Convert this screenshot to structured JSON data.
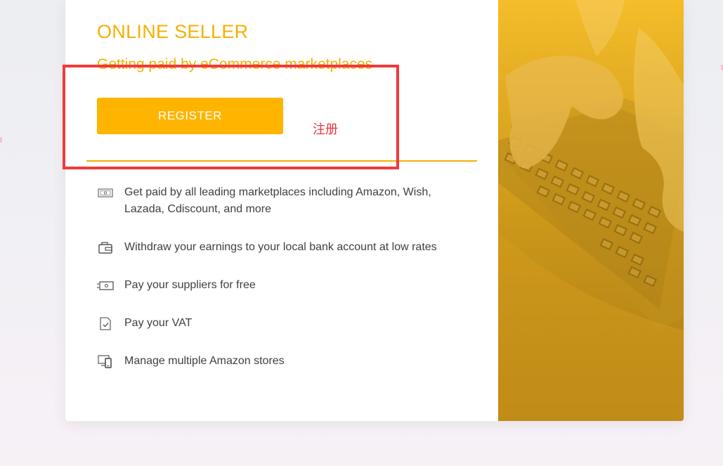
{
  "card": {
    "title": "ONLINE SELLER",
    "subtitle": "Getting paid by eCommerce marketplaces",
    "register_label": "REGISTER"
  },
  "features": [
    {
      "icon": "cash-icon",
      "text": "Get paid by all leading marketplaces including Amazon, Wish, Lazada, Cdiscount, and more"
    },
    {
      "icon": "wallet-icon",
      "text": "Withdraw your earnings to your local bank account at low rates"
    },
    {
      "icon": "money-transfer-icon",
      "text": "Pay your suppliers for free"
    },
    {
      "icon": "document-check-icon",
      "text": "Pay your VAT"
    },
    {
      "icon": "devices-icon",
      "text": "Manage multiple Amazon stores"
    }
  ],
  "annotation": {
    "label": "注册",
    "color": "#e8383d"
  },
  "colors": {
    "accent": "#f5b000",
    "button": "#ffb400",
    "annotation_box": "#f03a3a"
  }
}
